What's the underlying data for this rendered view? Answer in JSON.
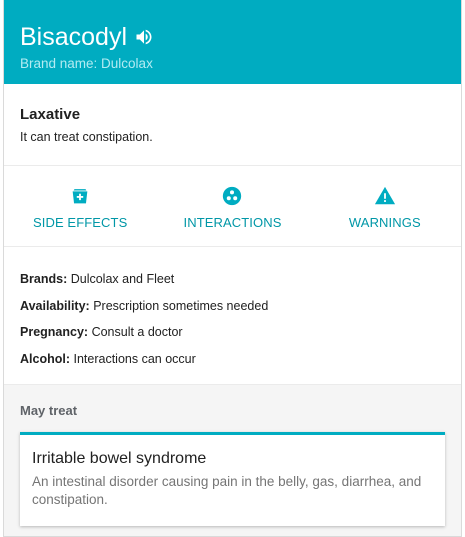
{
  "header": {
    "drug_name": "Bisacodyl",
    "brand_line": "Brand name: Dulcolax",
    "accent_color": "#00acc1",
    "speaker_icon": "volume-icon"
  },
  "drug_class": {
    "title": "Laxative",
    "description": "It can treat constipation."
  },
  "actions": [
    {
      "label": "SIDE EFFECTS",
      "icon": "side-effects-icon"
    },
    {
      "label": "INTERACTIONS",
      "icon": "interactions-icon"
    },
    {
      "label": "WARNINGS",
      "icon": "warning-icon"
    }
  ],
  "facts": [
    {
      "key": "Brands:",
      "value": "Dulcolax and Fleet"
    },
    {
      "key": "Availability:",
      "value": "Prescription sometimes needed"
    },
    {
      "key": "Pregnancy:",
      "value": "Consult a doctor"
    },
    {
      "key": "Alcohol:",
      "value": "Interactions can occur"
    }
  ],
  "may_treat": {
    "title": "May treat",
    "conditions": [
      {
        "name": "Irritable bowel syndrome",
        "description": "An intestinal disorder causing pain in the belly, gas, diarrhea, and constipation."
      }
    ]
  }
}
